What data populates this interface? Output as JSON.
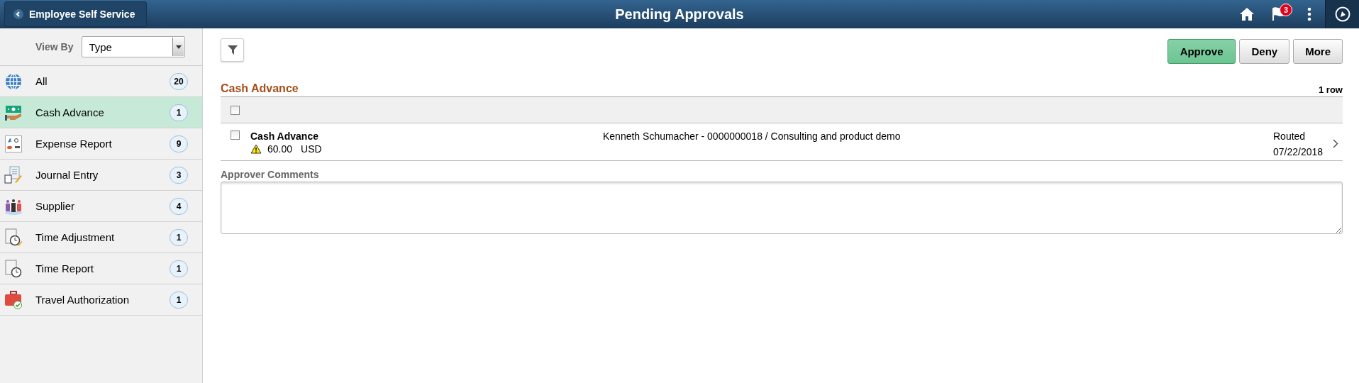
{
  "header": {
    "back_label": "Employee Self Service",
    "title": "Pending Approvals",
    "notification_count": "3"
  },
  "sidebar": {
    "view_by": {
      "label": "View By",
      "value": "Type"
    },
    "items": [
      {
        "kind": "globe",
        "label": "All",
        "count": "20",
        "selected": false
      },
      {
        "kind": "cash",
        "label": "Cash Advance",
        "count": "1",
        "selected": true
      },
      {
        "kind": "expense",
        "label": "Expense Report",
        "count": "9",
        "selected": false
      },
      {
        "kind": "journal",
        "label": "Journal Entry",
        "count": "3",
        "selected": false
      },
      {
        "kind": "supplier",
        "label": "Supplier",
        "count": "4",
        "selected": false
      },
      {
        "kind": "time-adjust",
        "label": "Time Adjustment",
        "count": "1",
        "selected": false
      },
      {
        "kind": "time-report",
        "label": "Time Report",
        "count": "1",
        "selected": false
      },
      {
        "kind": "travel",
        "label": "Travel Authorization",
        "count": "1",
        "selected": false
      }
    ]
  },
  "actions": [
    "Approve",
    "Deny",
    "More"
  ],
  "section": {
    "title": "Cash Advance",
    "row_count": "1 row",
    "select_all_checked": false,
    "rows": [
      {
        "checked": false,
        "type": "Cash Advance",
        "amount": "60.00",
        "currency": "USD",
        "description": "Kenneth Schumacher - 0000000018 / Consulting and product demo",
        "status": "Routed",
        "date": "07/22/2018"
      }
    ]
  },
  "comments": {
    "label": "Approver Comments"
  }
}
